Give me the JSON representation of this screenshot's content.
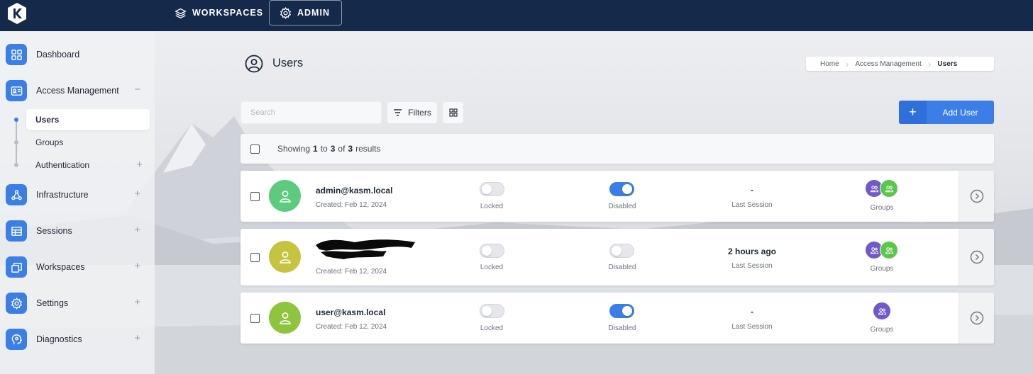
{
  "topbar": {
    "nav": [
      {
        "label": "WORKSPACES",
        "icon": "layers-icon"
      },
      {
        "label": "ADMIN",
        "icon": "gear-icon"
      }
    ]
  },
  "sidebar": {
    "items": [
      {
        "label": "Dashboard",
        "icon": "grid-icon",
        "toggle": ""
      },
      {
        "label": "Access Management",
        "icon": "id-card-icon",
        "toggle": "−"
      },
      {
        "label": "Infrastructure",
        "icon": "network-icon",
        "toggle": "+"
      },
      {
        "label": "Sessions",
        "icon": "table-icon",
        "toggle": "+"
      },
      {
        "label": "Workspaces",
        "icon": "windows-icon",
        "toggle": "+"
      },
      {
        "label": "Settings",
        "icon": "gear-icon",
        "toggle": "+"
      },
      {
        "label": "Diagnostics",
        "icon": "head-icon",
        "toggle": "+"
      }
    ],
    "access_sub": [
      {
        "label": "Users",
        "active": true,
        "toggle": ""
      },
      {
        "label": "Groups",
        "active": false,
        "toggle": ""
      },
      {
        "label": "Authentication",
        "active": false,
        "toggle": "+"
      }
    ]
  },
  "page": {
    "title": "Users",
    "breadcrumb": [
      "Home",
      "Access Management",
      "Users"
    ]
  },
  "toolbar": {
    "search_placeholder": "Search",
    "filters_label": "Filters",
    "add_user_plus": "+",
    "add_user_label": "Add User"
  },
  "results": {
    "prefix": "Showing",
    "from": "1",
    "to_word": "to",
    "to": "3",
    "of_word": "of",
    "total": "3",
    "suffix": "results"
  },
  "labels": {
    "locked": "Locked",
    "disabled": "Disabled",
    "last_session": "Last Session",
    "groups": "Groups"
  },
  "users": [
    {
      "name": "admin@kasm.local",
      "created": "Created: Feb 12, 2024",
      "locked": false,
      "disabled": true,
      "last_session": "-",
      "avatar_color": "#5ccb7e",
      "group_count": 2
    },
    {
      "name": "",
      "created": "Created: Feb 12, 2024",
      "locked": false,
      "disabled": false,
      "last_session": "2 hours ago",
      "avatar_color": "#c6c43f",
      "group_count": 2
    },
    {
      "name": "user@kasm.local",
      "created": "Created: Feb 12, 2024",
      "locked": false,
      "disabled": true,
      "last_session": "-",
      "avatar_color": "#8fc43f",
      "group_count": 1
    }
  ],
  "colors": {
    "topbar": "#15294a",
    "accent": "#3c7ee8",
    "group_purple": "#7258c9",
    "group_green": "#5ac64a"
  }
}
